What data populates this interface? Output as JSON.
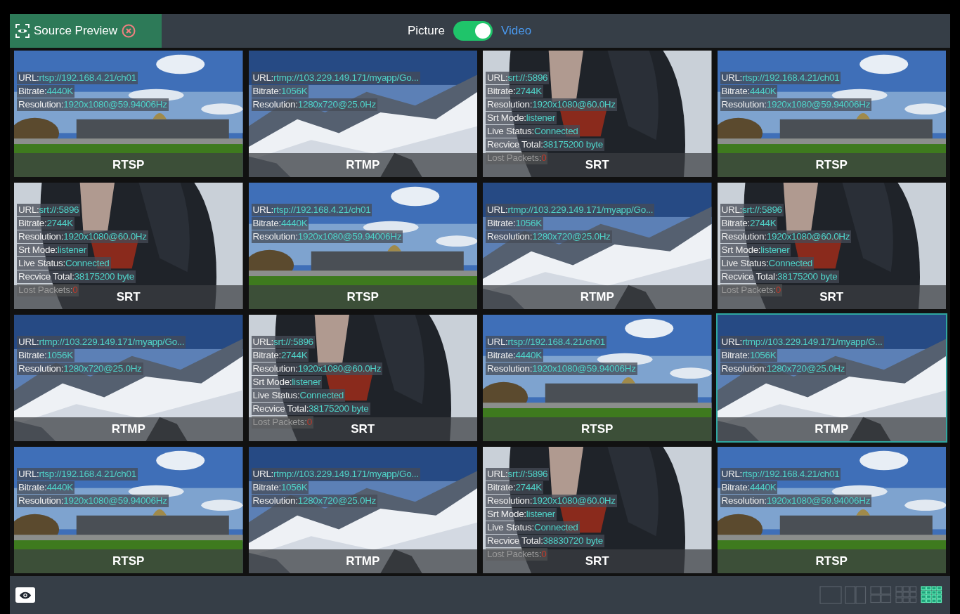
{
  "header": {
    "title": "Source Preview",
    "toggle": {
      "left_label": "Picture",
      "right_label": "Video",
      "on": true
    }
  },
  "tiles": [
    {
      "kind": "rtsp",
      "selected": false,
      "label": "RTSP",
      "lines": [
        {
          "label": "URL:",
          "value": "rtsp://192.168.4.21/ch01",
          "alert": false
        },
        {
          "label": "Bitrate:",
          "value": "4440K",
          "alert": false
        },
        {
          "label": "Resolution:",
          "value": "1920x1080@59.94006Hz",
          "alert": false
        }
      ]
    },
    {
      "kind": "rtmp",
      "selected": false,
      "label": "RTMP",
      "lines": [
        {
          "label": "URL:",
          "value": "rtmp://103.229.149.171/myapp/Go...",
          "alert": false
        },
        {
          "label": "Bitrate:",
          "value": "1056K",
          "alert": false
        },
        {
          "label": "Resolution:",
          "value": "1280x720@25.0Hz",
          "alert": false
        }
      ]
    },
    {
      "kind": "srt",
      "selected": false,
      "label": "SRT",
      "lines": [
        {
          "label": "URL:",
          "value": "srt://:5896",
          "alert": false
        },
        {
          "label": "Bitrate:",
          "value": "2744K",
          "alert": false
        },
        {
          "label": "Resolution:",
          "value": "1920x1080@60.0Hz",
          "alert": false
        },
        {
          "label": "Srt Mode:",
          "value": "listener",
          "alert": false
        },
        {
          "label": "Live Status:",
          "value": "Connected",
          "alert": false
        },
        {
          "label": "Recvice Total:",
          "value": "38175200 byte",
          "alert": false
        },
        {
          "label": "Lost Packets:",
          "value": "0",
          "alert": true
        }
      ]
    },
    {
      "kind": "rtsp",
      "selected": false,
      "label": "RTSP",
      "lines": [
        {
          "label": "URL:",
          "value": "rtsp://192.168.4.21/ch01",
          "alert": false
        },
        {
          "label": "Bitrate:",
          "value": "4440K",
          "alert": false
        },
        {
          "label": "Resolution:",
          "value": "1920x1080@59.94006Hz",
          "alert": false
        }
      ]
    },
    {
      "kind": "srt",
      "selected": false,
      "label": "SRT",
      "lines": [
        {
          "label": "URL:",
          "value": "srt://:5896",
          "alert": false
        },
        {
          "label": "Bitrate:",
          "value": "2744K",
          "alert": false
        },
        {
          "label": "Resolution:",
          "value": "1920x1080@60.0Hz",
          "alert": false
        },
        {
          "label": "Srt Mode:",
          "value": "listener",
          "alert": false
        },
        {
          "label": "Live Status:",
          "value": "Connected",
          "alert": false
        },
        {
          "label": "Recvice Total:",
          "value": "38175200 byte",
          "alert": false
        },
        {
          "label": "Lost Packets:",
          "value": "0",
          "alert": true
        }
      ]
    },
    {
      "kind": "rtsp",
      "selected": false,
      "label": "RTSP",
      "lines": [
        {
          "label": "URL:",
          "value": "rtsp://192.168.4.21/ch01",
          "alert": false
        },
        {
          "label": "Bitrate:",
          "value": "4440K",
          "alert": false
        },
        {
          "label": "Resolution:",
          "value": "1920x1080@59.94006Hz",
          "alert": false
        }
      ]
    },
    {
      "kind": "rtmp",
      "selected": false,
      "label": "RTMP",
      "lines": [
        {
          "label": "URL:",
          "value": "rtmp://103.229.149.171/myapp/Go...",
          "alert": false
        },
        {
          "label": "Bitrate:",
          "value": "1056K",
          "alert": false
        },
        {
          "label": "Resolution:",
          "value": "1280x720@25.0Hz",
          "alert": false
        }
      ]
    },
    {
      "kind": "srt",
      "selected": false,
      "label": "SRT",
      "lines": [
        {
          "label": "URL:",
          "value": "srt://:5896",
          "alert": false
        },
        {
          "label": "Bitrate:",
          "value": "2744K",
          "alert": false
        },
        {
          "label": "Resolution:",
          "value": "1920x1080@60.0Hz",
          "alert": false
        },
        {
          "label": "Srt Mode:",
          "value": "listener",
          "alert": false
        },
        {
          "label": "Live Status:",
          "value": "Connected",
          "alert": false
        },
        {
          "label": "Recvice Total:",
          "value": "38175200 byte",
          "alert": false
        },
        {
          "label": "Lost Packets:",
          "value": "0",
          "alert": true
        }
      ]
    },
    {
      "kind": "rtmp",
      "selected": false,
      "label": "RTMP",
      "lines": [
        {
          "label": "URL:",
          "value": "rtmp://103.229.149.171/myapp/Go...",
          "alert": false
        },
        {
          "label": "Bitrate:",
          "value": "1056K",
          "alert": false
        },
        {
          "label": "Resolution:",
          "value": "1280x720@25.0Hz",
          "alert": false
        }
      ]
    },
    {
      "kind": "srt",
      "selected": false,
      "label": "SRT",
      "lines": [
        {
          "label": "URL:",
          "value": "srt://:5896",
          "alert": false
        },
        {
          "label": "Bitrate:",
          "value": "2744K",
          "alert": false
        },
        {
          "label": "Resolution:",
          "value": "1920x1080@60.0Hz",
          "alert": false
        },
        {
          "label": "Srt Mode:",
          "value": "listener",
          "alert": false
        },
        {
          "label": "Live Status:",
          "value": "Connected",
          "alert": false
        },
        {
          "label": "Recvice Total:",
          "value": "38175200 byte",
          "alert": false
        },
        {
          "label": "Lost Packets:",
          "value": "0",
          "alert": true
        }
      ]
    },
    {
      "kind": "rtsp",
      "selected": false,
      "label": "RTSP",
      "lines": [
        {
          "label": "URL:",
          "value": "rtsp://192.168.4.21/ch01",
          "alert": false
        },
        {
          "label": "Bitrate:",
          "value": "4440K",
          "alert": false
        },
        {
          "label": "Resolution:",
          "value": "1920x1080@59.94006Hz",
          "alert": false
        }
      ]
    },
    {
      "kind": "rtmp",
      "selected": true,
      "label": "RTMP",
      "lines": [
        {
          "label": "URL:",
          "value": "rtmp://103.229.149.171/myapp/G...",
          "alert": false
        },
        {
          "label": "Bitrate:",
          "value": "1056K",
          "alert": false
        },
        {
          "label": "Resolution:",
          "value": "1280x720@25.0Hz",
          "alert": false
        }
      ]
    },
    {
      "kind": "rtsp",
      "selected": false,
      "label": "RTSP",
      "lines": [
        {
          "label": "URL:",
          "value": "rtsp://192.168.4.21/ch01",
          "alert": false
        },
        {
          "label": "Bitrate:",
          "value": "4440K",
          "alert": false
        },
        {
          "label": "Resolution:",
          "value": "1920x1080@59.94006Hz",
          "alert": false
        }
      ]
    },
    {
      "kind": "rtmp",
      "selected": false,
      "label": "RTMP",
      "lines": [
        {
          "label": "URL:",
          "value": "rtmp://103.229.149.171/myapp/Go...",
          "alert": false
        },
        {
          "label": "Bitrate:",
          "value": "1056K",
          "alert": false
        },
        {
          "label": "Resolution:",
          "value": "1280x720@25.0Hz",
          "alert": false
        }
      ]
    },
    {
      "kind": "srt",
      "selected": false,
      "label": "SRT",
      "lines": [
        {
          "label": "URL:",
          "value": "srt://:5896",
          "alert": false
        },
        {
          "label": "Bitrate:",
          "value": "2744K",
          "alert": false
        },
        {
          "label": "Resolution:",
          "value": "1920x1080@60.0Hz",
          "alert": false
        },
        {
          "label": "Srt Mode:",
          "value": "listener",
          "alert": false
        },
        {
          "label": "Live Status:",
          "value": "Connected",
          "alert": false
        },
        {
          "label": "Recvice Total:",
          "value": "38830720 byte",
          "alert": false
        },
        {
          "label": "Lost Packets:",
          "value": "0",
          "alert": true
        }
      ]
    },
    {
      "kind": "rtsp",
      "selected": false,
      "label": "RTSP",
      "lines": [
        {
          "label": "URL:",
          "value": "rtsp://192.168.4.21/ch01",
          "alert": false
        },
        {
          "label": "Bitrate:",
          "value": "4440K",
          "alert": false
        },
        {
          "label": "Resolution:",
          "value": "1920x1080@59.94006Hz",
          "alert": false
        }
      ]
    }
  ],
  "layouts": [
    {
      "kind": "single",
      "selected": false
    },
    {
      "kind": "two",
      "selected": false
    },
    {
      "kind": "four",
      "selected": false
    },
    {
      "kind": "nine",
      "selected": false
    },
    {
      "kind": "sixteen",
      "selected": true
    }
  ]
}
